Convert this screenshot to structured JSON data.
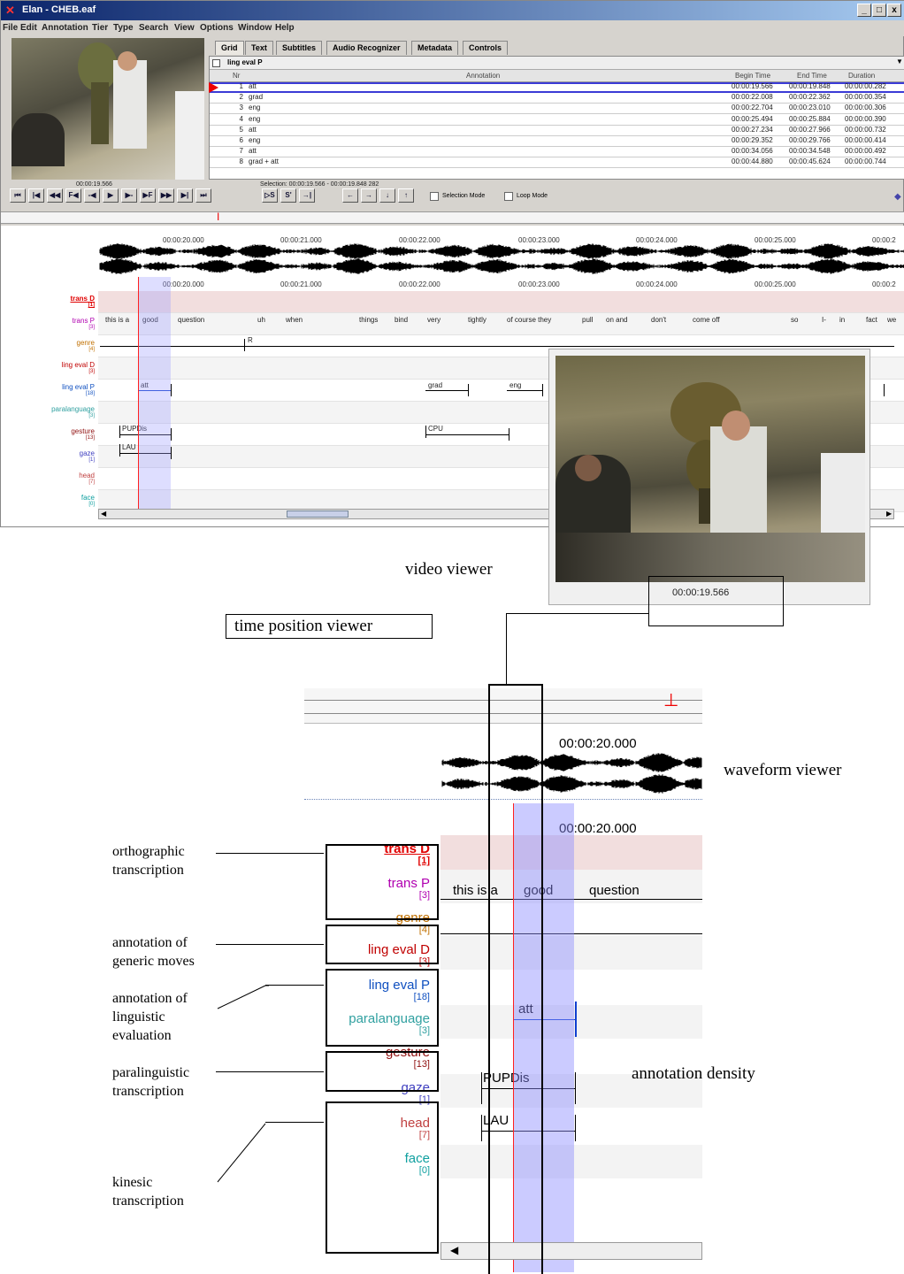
{
  "window": {
    "title": "Elan - CHEB.eaf",
    "buttons": [
      "_",
      "□",
      "x"
    ]
  },
  "menu": [
    "File",
    "Edit",
    "Annotation",
    "Tier",
    "Type",
    "Search",
    "View",
    "Options",
    "Window",
    "Help"
  ],
  "tabs": [
    "Grid",
    "Text",
    "Subtitles",
    "Audio Recognizer",
    "Metadata",
    "Controls"
  ],
  "grid": {
    "tier": "ling eval P",
    "headers": [
      "Nr",
      "Annotation",
      "Begin Time",
      "End Time",
      "Duration"
    ],
    "rows": [
      {
        "nr": "1",
        "annotation": "att",
        "begin": "00:00:19.566",
        "end": "00:00:19.848",
        "duration": "00:00:00.282"
      },
      {
        "nr": "2",
        "annotation": "grad",
        "begin": "00:00:22.008",
        "end": "00:00:22.362",
        "duration": "00:00:00.354"
      },
      {
        "nr": "3",
        "annotation": "eng",
        "begin": "00:00:22.704",
        "end": "00:00:23.010",
        "duration": "00:00:00.306"
      },
      {
        "nr": "4",
        "annotation": "eng",
        "begin": "00:00:25.494",
        "end": "00:00:25.884",
        "duration": "00:00:00.390"
      },
      {
        "nr": "5",
        "annotation": "att",
        "begin": "00:00:27.234",
        "end": "00:00:27.966",
        "duration": "00:00:00.732"
      },
      {
        "nr": "6",
        "annotation": "eng",
        "begin": "00:00:29.352",
        "end": "00:00:29.766",
        "duration": "00:00:00.414"
      },
      {
        "nr": "7",
        "annotation": "att",
        "begin": "00:00:34.056",
        "end": "00:00:34.548",
        "duration": "00:00:00.492"
      },
      {
        "nr": "8",
        "annotation": "grad + att",
        "begin": "00:00:44.880",
        "end": "00:00:45.624",
        "duration": "00:00:00.744"
      }
    ]
  },
  "player": {
    "time": "00:00:19.566",
    "selection": "Selection: 00:00:19.566 - 00:00:19.848  282",
    "selection_mode": "Selection Mode",
    "loop_mode": "Loop Mode"
  },
  "timeline": {
    "ticks": [
      "00:00:20.000",
      "00:00:21.000",
      "00:00:22.000",
      "00:00:23.000",
      "00:00:24.000",
      "00:00:25.000",
      "00:00:2"
    ]
  },
  "tiers": [
    {
      "name": "trans D",
      "count": "[1]",
      "color": "#e00000"
    },
    {
      "name": "trans P",
      "count": "[3]",
      "color": "#b000b0"
    },
    {
      "name": "genre",
      "count": "[4]",
      "color": "#c07000"
    },
    {
      "name": "ling eval D",
      "count": "[3]",
      "color": "#c00000"
    },
    {
      "name": "ling eval P",
      "count": "[18]",
      "color": "#1050c0"
    },
    {
      "name": "paralanguage",
      "count": "[3]",
      "color": "#30a0a0"
    },
    {
      "name": "gesture",
      "count": "[13]",
      "color": "#901010"
    },
    {
      "name": "gaze",
      "count": "[1]",
      "color": "#4040c0"
    },
    {
      "name": "head",
      "count": "[7]",
      "color": "#c04040"
    },
    {
      "name": "face",
      "count": "[0]",
      "color": "#10a0a0"
    }
  ],
  "words": [
    "this is a",
    "good",
    "question",
    "uh",
    "when",
    "things",
    "bind",
    "very",
    "tightly",
    "of course they",
    "pull",
    "on and",
    "don't",
    "come off",
    "so",
    "I-",
    "in",
    "fact",
    "we"
  ],
  "annotations": {
    "genre": "R",
    "ling_eval_p": [
      "att",
      "grad",
      "eng"
    ],
    "gesture": [
      "PUPDis",
      "CPU"
    ],
    "gaze": "LAU"
  },
  "callouts": {
    "video_viewer": "video viewer",
    "time_position_viewer": "time position viewer",
    "waveform_viewer": "waveform viewer",
    "annotation_density": "annotation density",
    "orthographic": "orthographic transcription",
    "generic": "annotation of generic moves",
    "linguistic": "annotation of linguistic evaluation",
    "paralinguistic": "paralinguistic transcription",
    "kinesic": "kinesic transcription"
  },
  "zoom": {
    "tick": "00:00:20.000",
    "words": [
      "this is a",
      "good",
      "question"
    ]
  },
  "colors": {
    "cursor": "#ff2020",
    "selection": "#c8c8ff",
    "titlebar": "#0a246a"
  }
}
